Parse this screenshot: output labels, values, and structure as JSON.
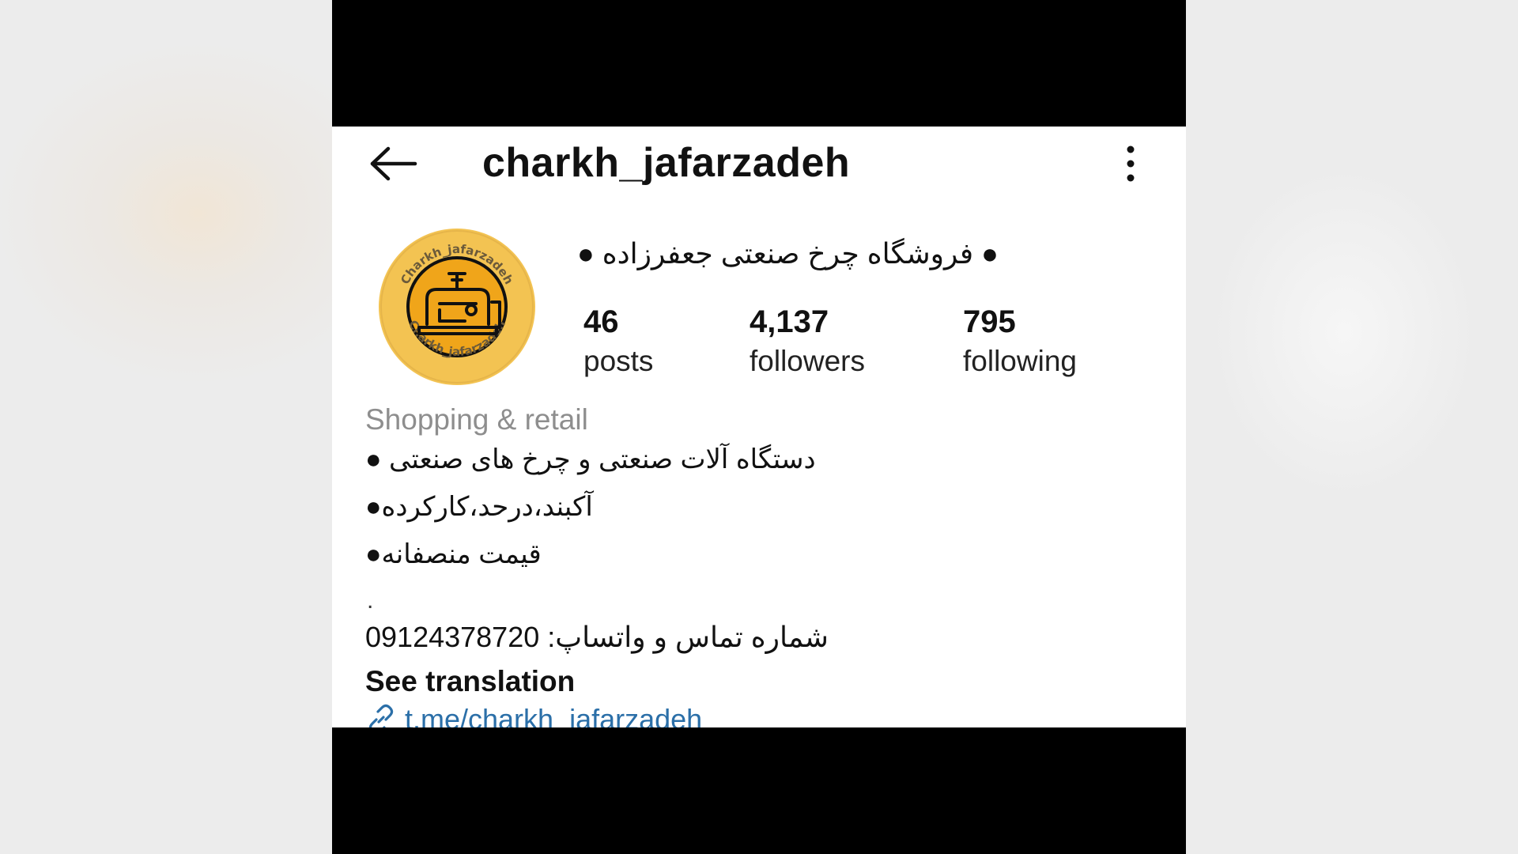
{
  "header": {
    "username": "charkh_jafarzadeh"
  },
  "profile": {
    "display_name": "● فروشگاه چرخ صنعتی جعفرزاده ●",
    "avatar_text_top": "Charkh_jafarzadeh",
    "avatar_text_bottom": "Charkh_jafarzadeh",
    "stats": [
      {
        "value": "46",
        "label": "posts"
      },
      {
        "value": "4,137",
        "label": "followers"
      },
      {
        "value": "795",
        "label": "following"
      }
    ],
    "category": "Shopping & retail",
    "bio": [
      "● دستگاه آلات صنعتی و چرخ های صنعتی",
      "●آکبند،درحد،کارکرده",
      "●قیمت منصفانه"
    ],
    "bio_dot": ".",
    "contact": "شماره تماس و واتساپ: 09124378720",
    "see_translation": "See translation",
    "link": "t.me/charkh_jafarzadeh"
  },
  "colors": {
    "link": "#2b6fa8",
    "avatar_outer": "#f2c04a",
    "avatar_inner": "#f0a30a",
    "category": "#8e8e8e"
  },
  "icons": [
    "back-arrow-icon",
    "more-options-icon",
    "link-icon"
  ]
}
